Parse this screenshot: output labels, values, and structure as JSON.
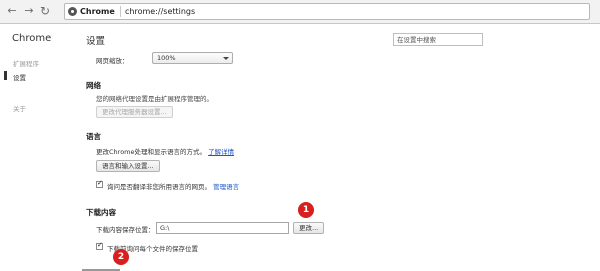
{
  "toolbar": {
    "back_icon": "arrow-left-icon",
    "forward_icon": "arrow-right-icon",
    "reload_icon": "reload-icon",
    "site_name": "Chrome",
    "url": "chrome://settings"
  },
  "sidebar": {
    "title": "Chrome",
    "items": [
      {
        "label": "扩展程序"
      },
      {
        "label": "设置"
      },
      {
        "label": "关于"
      }
    ]
  },
  "main": {
    "title": "设置",
    "search_placeholder": "在设置中搜索",
    "zoom": {
      "label": "网页缩放：",
      "value": "100%"
    },
    "network": {
      "title": "网络",
      "description": "您的网络代理设置是由扩展程序管理的。",
      "button": "更改代理服务器设置..."
    },
    "language": {
      "title": "语言",
      "description": "更改Chrome处理和显示语言的方式。",
      "learn_more": "了解详情",
      "button": "语言和输入设置...",
      "translate_checkbox": "询问是否翻译非您所用语言的网页。",
      "manage_languages": "管理语言"
    },
    "downloads": {
      "title": "下载内容",
      "location_label": "下载内容保存位置：",
      "location_value": "G:\\",
      "change_button": "更改...",
      "ask_checkbox": "下载前询问每个文件的保存位置"
    }
  },
  "annotations": [
    {
      "label": "1",
      "color": "#d81e1e"
    },
    {
      "label": "2",
      "color": "#d81e1e"
    }
  ]
}
